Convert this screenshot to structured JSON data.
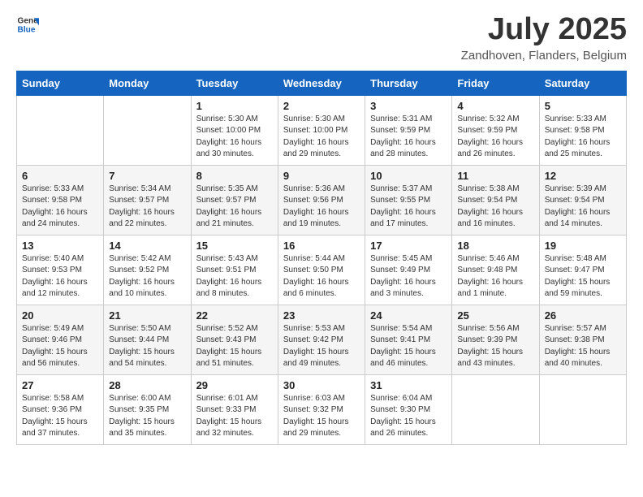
{
  "header": {
    "logo_general": "General",
    "logo_blue": "Blue",
    "month_title": "July 2025",
    "location": "Zandhoven, Flanders, Belgium"
  },
  "weekdays": [
    "Sunday",
    "Monday",
    "Tuesday",
    "Wednesday",
    "Thursday",
    "Friday",
    "Saturday"
  ],
  "weeks": [
    [
      {
        "day": "",
        "info": ""
      },
      {
        "day": "",
        "info": ""
      },
      {
        "day": "1",
        "info": "Sunrise: 5:30 AM\nSunset: 10:00 PM\nDaylight: 16 hours\nand 30 minutes."
      },
      {
        "day": "2",
        "info": "Sunrise: 5:30 AM\nSunset: 10:00 PM\nDaylight: 16 hours\nand 29 minutes."
      },
      {
        "day": "3",
        "info": "Sunrise: 5:31 AM\nSunset: 9:59 PM\nDaylight: 16 hours\nand 28 minutes."
      },
      {
        "day": "4",
        "info": "Sunrise: 5:32 AM\nSunset: 9:59 PM\nDaylight: 16 hours\nand 26 minutes."
      },
      {
        "day": "5",
        "info": "Sunrise: 5:33 AM\nSunset: 9:58 PM\nDaylight: 16 hours\nand 25 minutes."
      }
    ],
    [
      {
        "day": "6",
        "info": "Sunrise: 5:33 AM\nSunset: 9:58 PM\nDaylight: 16 hours\nand 24 minutes."
      },
      {
        "day": "7",
        "info": "Sunrise: 5:34 AM\nSunset: 9:57 PM\nDaylight: 16 hours\nand 22 minutes."
      },
      {
        "day": "8",
        "info": "Sunrise: 5:35 AM\nSunset: 9:57 PM\nDaylight: 16 hours\nand 21 minutes."
      },
      {
        "day": "9",
        "info": "Sunrise: 5:36 AM\nSunset: 9:56 PM\nDaylight: 16 hours\nand 19 minutes."
      },
      {
        "day": "10",
        "info": "Sunrise: 5:37 AM\nSunset: 9:55 PM\nDaylight: 16 hours\nand 17 minutes."
      },
      {
        "day": "11",
        "info": "Sunrise: 5:38 AM\nSunset: 9:54 PM\nDaylight: 16 hours\nand 16 minutes."
      },
      {
        "day": "12",
        "info": "Sunrise: 5:39 AM\nSunset: 9:54 PM\nDaylight: 16 hours\nand 14 minutes."
      }
    ],
    [
      {
        "day": "13",
        "info": "Sunrise: 5:40 AM\nSunset: 9:53 PM\nDaylight: 16 hours\nand 12 minutes."
      },
      {
        "day": "14",
        "info": "Sunrise: 5:42 AM\nSunset: 9:52 PM\nDaylight: 16 hours\nand 10 minutes."
      },
      {
        "day": "15",
        "info": "Sunrise: 5:43 AM\nSunset: 9:51 PM\nDaylight: 16 hours\nand 8 minutes."
      },
      {
        "day": "16",
        "info": "Sunrise: 5:44 AM\nSunset: 9:50 PM\nDaylight: 16 hours\nand 6 minutes."
      },
      {
        "day": "17",
        "info": "Sunrise: 5:45 AM\nSunset: 9:49 PM\nDaylight: 16 hours\nand 3 minutes."
      },
      {
        "day": "18",
        "info": "Sunrise: 5:46 AM\nSunset: 9:48 PM\nDaylight: 16 hours\nand 1 minute."
      },
      {
        "day": "19",
        "info": "Sunrise: 5:48 AM\nSunset: 9:47 PM\nDaylight: 15 hours\nand 59 minutes."
      }
    ],
    [
      {
        "day": "20",
        "info": "Sunrise: 5:49 AM\nSunset: 9:46 PM\nDaylight: 15 hours\nand 56 minutes."
      },
      {
        "day": "21",
        "info": "Sunrise: 5:50 AM\nSunset: 9:44 PM\nDaylight: 15 hours\nand 54 minutes."
      },
      {
        "day": "22",
        "info": "Sunrise: 5:52 AM\nSunset: 9:43 PM\nDaylight: 15 hours\nand 51 minutes."
      },
      {
        "day": "23",
        "info": "Sunrise: 5:53 AM\nSunset: 9:42 PM\nDaylight: 15 hours\nand 49 minutes."
      },
      {
        "day": "24",
        "info": "Sunrise: 5:54 AM\nSunset: 9:41 PM\nDaylight: 15 hours\nand 46 minutes."
      },
      {
        "day": "25",
        "info": "Sunrise: 5:56 AM\nSunset: 9:39 PM\nDaylight: 15 hours\nand 43 minutes."
      },
      {
        "day": "26",
        "info": "Sunrise: 5:57 AM\nSunset: 9:38 PM\nDaylight: 15 hours\nand 40 minutes."
      }
    ],
    [
      {
        "day": "27",
        "info": "Sunrise: 5:58 AM\nSunset: 9:36 PM\nDaylight: 15 hours\nand 37 minutes."
      },
      {
        "day": "28",
        "info": "Sunrise: 6:00 AM\nSunset: 9:35 PM\nDaylight: 15 hours\nand 35 minutes."
      },
      {
        "day": "29",
        "info": "Sunrise: 6:01 AM\nSunset: 9:33 PM\nDaylight: 15 hours\nand 32 minutes."
      },
      {
        "day": "30",
        "info": "Sunrise: 6:03 AM\nSunset: 9:32 PM\nDaylight: 15 hours\nand 29 minutes."
      },
      {
        "day": "31",
        "info": "Sunrise: 6:04 AM\nSunset: 9:30 PM\nDaylight: 15 hours\nand 26 minutes."
      },
      {
        "day": "",
        "info": ""
      },
      {
        "day": "",
        "info": ""
      }
    ]
  ]
}
